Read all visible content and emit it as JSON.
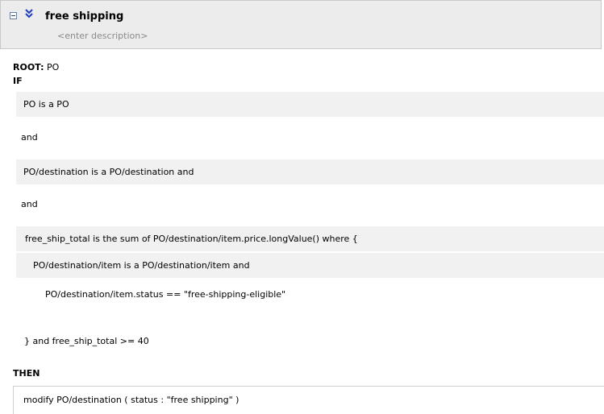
{
  "rule": {
    "title": "free shipping",
    "description": "<enter description>"
  },
  "root": {
    "keyword": "ROOT:",
    "value": "PO"
  },
  "if_keyword": "IF",
  "then_keyword": "THEN",
  "conditions": [
    "PO is a PO",
    "and",
    "PO/destination is a PO/destination  and",
    "and",
    "free_ship_total is the sum of PO/destination/item.price.longValue() where {",
    "PO/destination/item is a PO/destination/item  and",
    "PO/destination/item.status  ==  \"free-shipping-eligible\"",
    "} and  free_ship_total  >=  40"
  ],
  "action": "modify PO/destination (  status : \"free shipping\"  )",
  "icons": {
    "toggle": "collapse-toggle-icon",
    "chevron": "double-chevron-down-icon"
  },
  "colors": {
    "header_bg": "#ececec",
    "row_shade": "#f1f1f1",
    "chevron": "#1f3fbf",
    "description": "#8a8a8a"
  }
}
